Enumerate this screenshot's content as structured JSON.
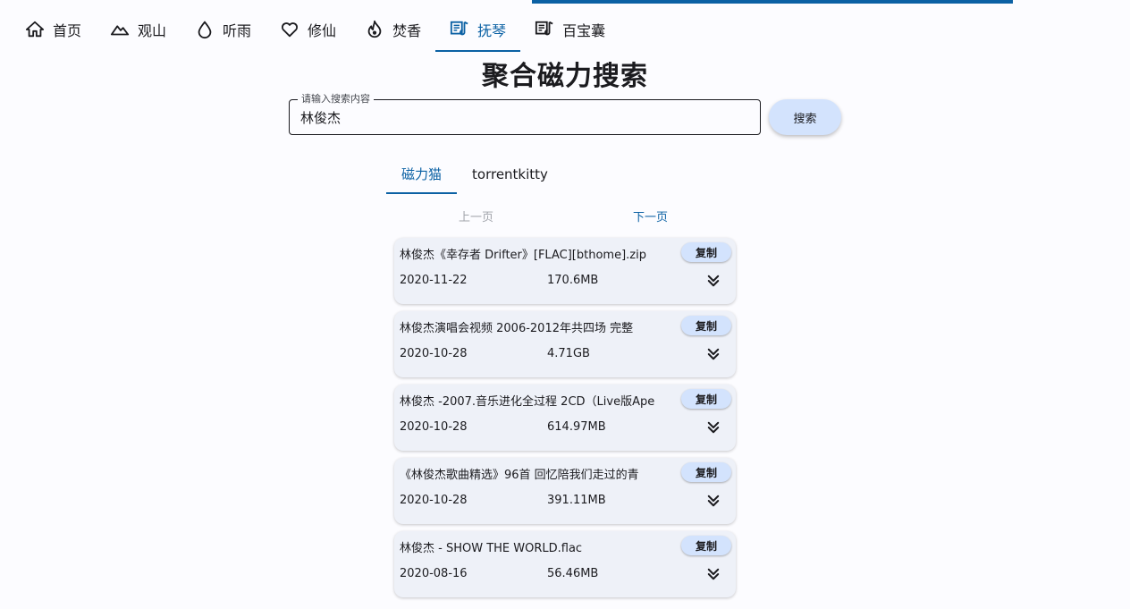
{
  "nav": {
    "items": [
      {
        "label": "首页",
        "icon": "home-icon"
      },
      {
        "label": "观山",
        "icon": "mountain-icon"
      },
      {
        "label": "听雨",
        "icon": "water-drop-icon"
      },
      {
        "label": "修仙",
        "icon": "heart-icon"
      },
      {
        "label": "焚香",
        "icon": "flame-icon"
      },
      {
        "label": "抚琴",
        "icon": "music-note-icon",
        "active": true
      },
      {
        "label": "百宝囊",
        "icon": "music-note-icon"
      }
    ],
    "accent_color": "#0b61a4"
  },
  "page": {
    "title": "聚合磁力搜索"
  },
  "search": {
    "label": "请输入搜索内容",
    "value": "林俊杰",
    "button_label": "搜索"
  },
  "tabs": [
    {
      "label": "磁力猫",
      "active": true
    },
    {
      "label": "torrentkitty",
      "active": false
    }
  ],
  "pagination": {
    "prev_label": "上一页",
    "next_label": "下一页"
  },
  "results": [
    {
      "name": "林俊杰《幸存者 Drifter》[FLAC][bthome].zip",
      "date": "2020-11-22",
      "size": "170.6MB",
      "copy_label": "复制"
    },
    {
      "name": "林俊杰演唱会视频 2006-2012年共四场 完整",
      "date": "2020-10-28",
      "size": "4.71GB",
      "copy_label": "复制"
    },
    {
      "name": "林俊杰 -2007.音乐进化全过程 2CD（Live版Ape",
      "date": "2020-10-28",
      "size": "614.97MB",
      "copy_label": "复制"
    },
    {
      "name": "《林俊杰歌曲精选》96首 回忆陪我们走过的青",
      "date": "2020-10-28",
      "size": "391.11MB",
      "copy_label": "复制"
    },
    {
      "name": "林俊杰 - SHOW THE WORLD.flac",
      "date": "2020-08-16",
      "size": "56.46MB",
      "copy_label": "复制"
    }
  ]
}
